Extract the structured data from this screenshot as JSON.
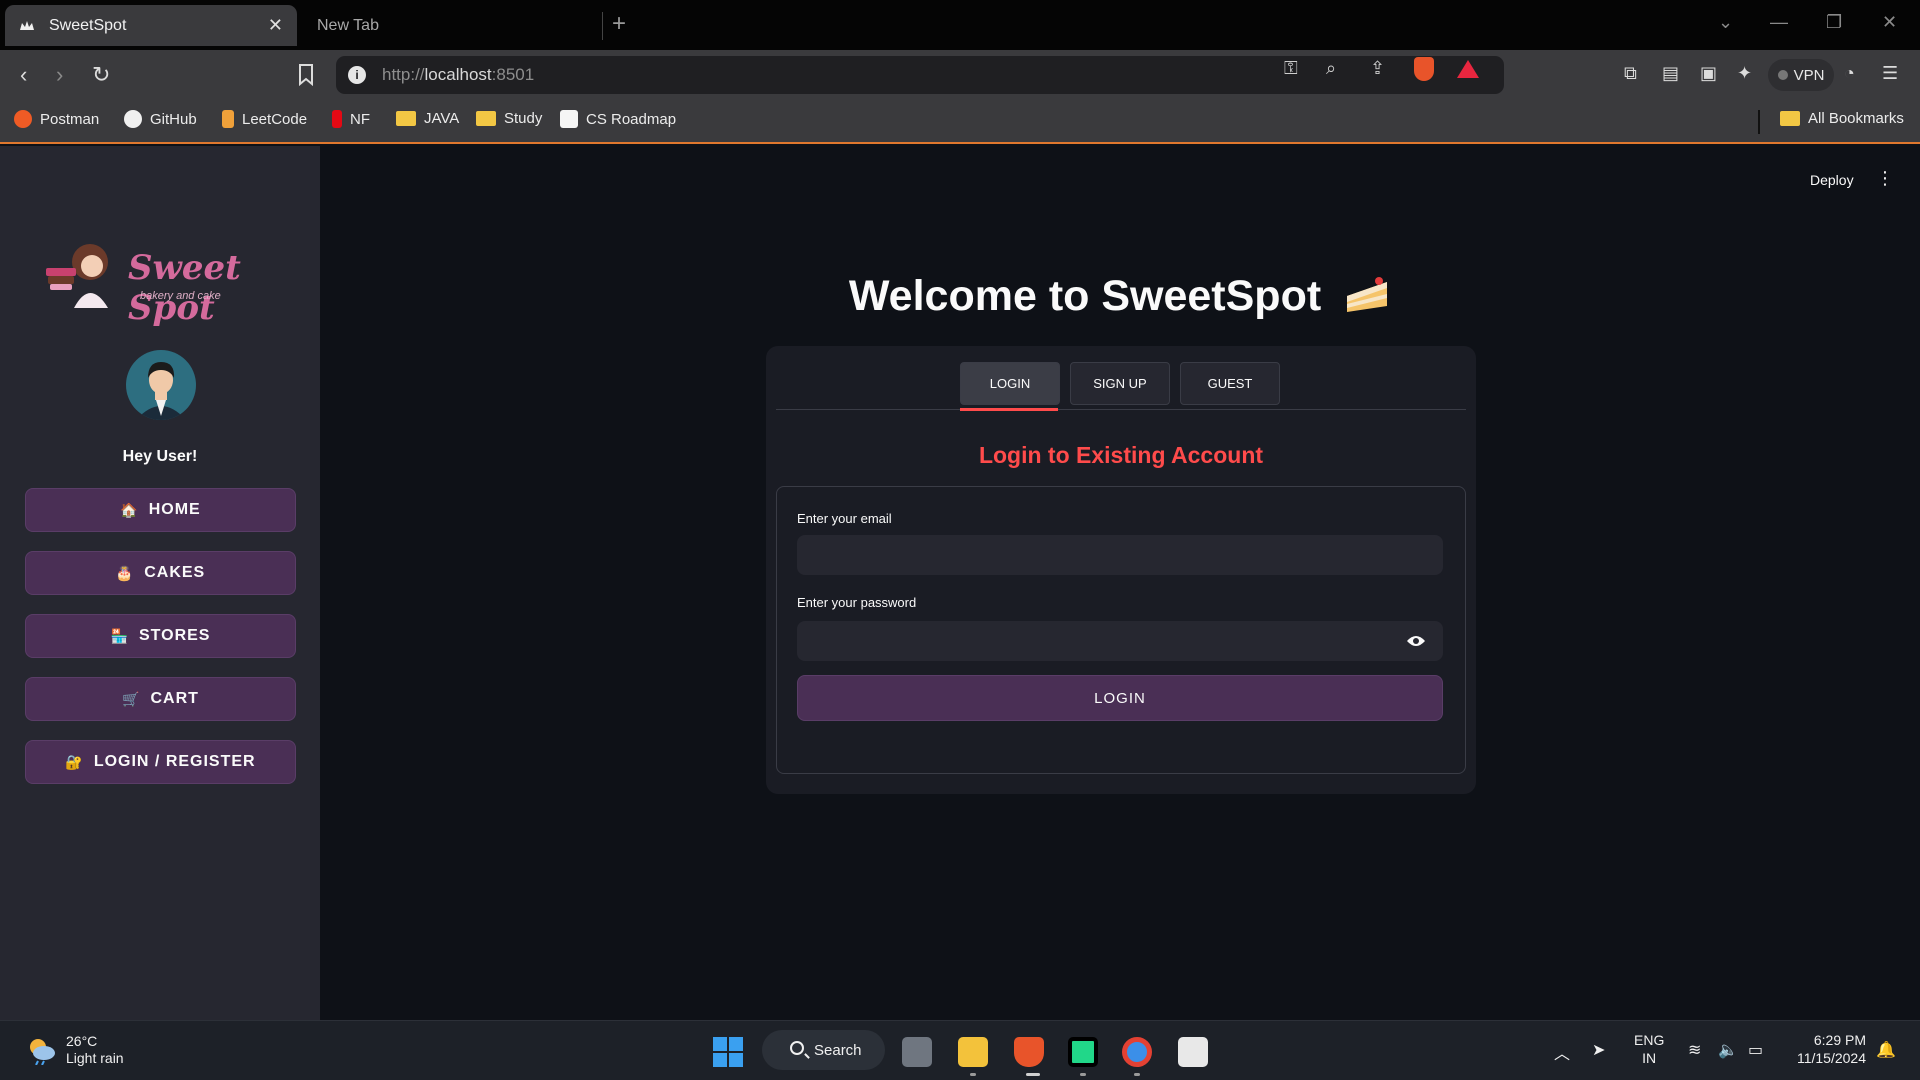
{
  "browser": {
    "tabs": [
      {
        "title": "SweetSpot",
        "active": true
      },
      {
        "title": "New Tab",
        "active": false
      }
    ],
    "url_host": "http://",
    "url_main": "localhost",
    "url_port": ":8501",
    "vpn_label": "VPN",
    "brave_badge": "1",
    "bookmarks": [
      "Postman",
      "GitHub",
      "LeetCode",
      "NF",
      "JAVA",
      "Study",
      "CS Roadmap"
    ],
    "all_bookmarks": "All Bookmarks"
  },
  "app": {
    "deploy_label": "Deploy",
    "sidebar": {
      "logo_brand": "Sweet Spot",
      "logo_tagline": "bakery and cake",
      "greeting": "Hey User!",
      "nav": [
        {
          "icon": "🏠",
          "label": "HOME"
        },
        {
          "icon": "🎂",
          "label": "CAKES"
        },
        {
          "icon": "🏪",
          "label": "STORES"
        },
        {
          "icon": "🛒",
          "label": "CART"
        },
        {
          "icon": "🔐",
          "label": "LOGIN / REGISTER"
        }
      ]
    },
    "main": {
      "heading": "Welcome to SweetSpot",
      "tabs": [
        "LOGIN",
        "SIGN UP",
        "GUEST"
      ],
      "active_tab": "LOGIN",
      "form_title": "Login to Existing Account",
      "email_label": "Enter your email",
      "email_value": "",
      "password_label": "Enter your password",
      "password_value": "",
      "submit_label": "LOGIN"
    }
  },
  "taskbar": {
    "temperature": "26°C",
    "weather": "Light rain",
    "search_label": "Search",
    "lang_top": "ENG",
    "lang_bottom": "IN",
    "time": "6:29 PM",
    "date": "11/15/2024"
  },
  "colors": {
    "accent_red": "#ff4b4b",
    "button_purple": "#4a2f55",
    "sidebar_bg": "#262730",
    "main_bg": "#0e1117"
  }
}
